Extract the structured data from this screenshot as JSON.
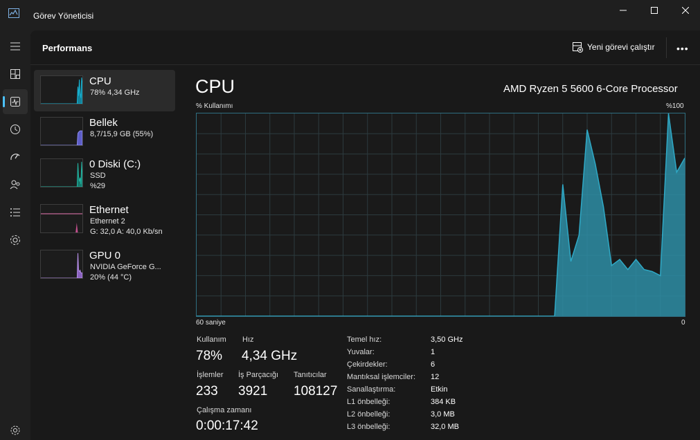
{
  "window": {
    "title": "Görev Yöneticisi",
    "icon": "task-manager-icon"
  },
  "nav": {
    "items": [
      {
        "icon": "menu-icon"
      },
      {
        "icon": "processes-icon"
      },
      {
        "icon": "performance-icon"
      },
      {
        "icon": "app-history-icon"
      },
      {
        "icon": "startup-apps-icon"
      },
      {
        "icon": "users-icon"
      },
      {
        "icon": "details-icon"
      },
      {
        "icon": "services-icon"
      }
    ],
    "settings_icon": "settings-icon",
    "active_index": 2,
    "accent": "#4cc2ff"
  },
  "header": {
    "title": "Performans",
    "run_task": "Yeni görevi çalıştır",
    "more": "•••"
  },
  "list": [
    {
      "name": "CPU",
      "sub1": "78%  4,34 GHz",
      "sub2": "",
      "color": "#17b3d3",
      "fill": "#13839b"
    },
    {
      "name": "Bellek",
      "sub1": "8,7/15,9 GB (55%)",
      "sub2": "",
      "color": "#8d8df0",
      "fill": "#5d5dc7"
    },
    {
      "name": "0 Diski (C:)",
      "sub1": "SSD",
      "sub2": "%29",
      "color": "#22b3a0",
      "fill": "#157a6d"
    },
    {
      "name": "Ethernet",
      "sub1": "Ethernet 2",
      "sub2": "G: 32,0 A: 40,0 Kb/sn",
      "color": "#ee7ab8",
      "fill": "#c4508f"
    },
    {
      "name": "GPU 0",
      "sub1": "NVIDIA GeForce G...",
      "sub2": "20%  (44 °C)",
      "color": "#b58ee6",
      "fill": "#8a62c0"
    }
  ],
  "detail": {
    "title": "CPU",
    "processor": "AMD Ryzen 5 5600 6-Core Processor",
    "axis_top_left": "% Kullanımı",
    "axis_top_right": "%100",
    "axis_bottom_left": "60 saniye",
    "axis_bottom_right": "0",
    "stats": {
      "usage_label": "Kullanım",
      "usage_value": "78%",
      "speed_label": "Hız",
      "speed_value": "4,34 GHz",
      "processes_label": "İşlemler",
      "processes_value": "233",
      "threads_label": "İş Parçacığı",
      "threads_value": "3921",
      "handles_label": "Tanıtıcılar",
      "handles_value": "108127",
      "uptime_label": "Çalışma zamanı",
      "uptime_value": "0:00:17:42"
    },
    "specs": [
      {
        "label": "Temel hız:",
        "value": "3,50 GHz"
      },
      {
        "label": "Yuvalar:",
        "value": "1"
      },
      {
        "label": "Çekirdekler:",
        "value": "6"
      },
      {
        "label": "Mantıksal işlemciler:",
        "value": "12"
      },
      {
        "label": "Sanallaştırma:",
        "value": "Etkin"
      },
      {
        "label": "L1 önbelleği:",
        "value": "384 KB"
      },
      {
        "label": "L2 önbelleği:",
        "value": "3,0 MB"
      },
      {
        "label": "L3 önbelleği:",
        "value": "32,0 MB"
      }
    ]
  },
  "chart_data": {
    "type": "area",
    "xlabel": "60 saniye",
    "ylabel": "% Kullanımı",
    "xlim": [
      60,
      0
    ],
    "ylim": [
      0,
      100
    ],
    "grid": true,
    "x": [
      60,
      58,
      56,
      54,
      52,
      50,
      48,
      46,
      44,
      42,
      40,
      38,
      36,
      34,
      32,
      30,
      28,
      26,
      24,
      22,
      20,
      18,
      16,
      15,
      14,
      13,
      12,
      11,
      10,
      9,
      8,
      7,
      6,
      5,
      4,
      3,
      2,
      1,
      0
    ],
    "values": [
      0,
      0,
      0,
      0,
      0,
      0,
      0,
      0,
      0,
      0,
      0,
      0,
      0,
      0,
      0,
      0,
      0,
      0,
      0,
      0,
      0,
      0,
      0,
      65,
      27,
      40,
      92,
      75,
      54,
      25,
      28,
      23,
      28,
      23,
      22,
      20,
      100,
      71,
      78
    ],
    "color": "#2fa9c6"
  }
}
